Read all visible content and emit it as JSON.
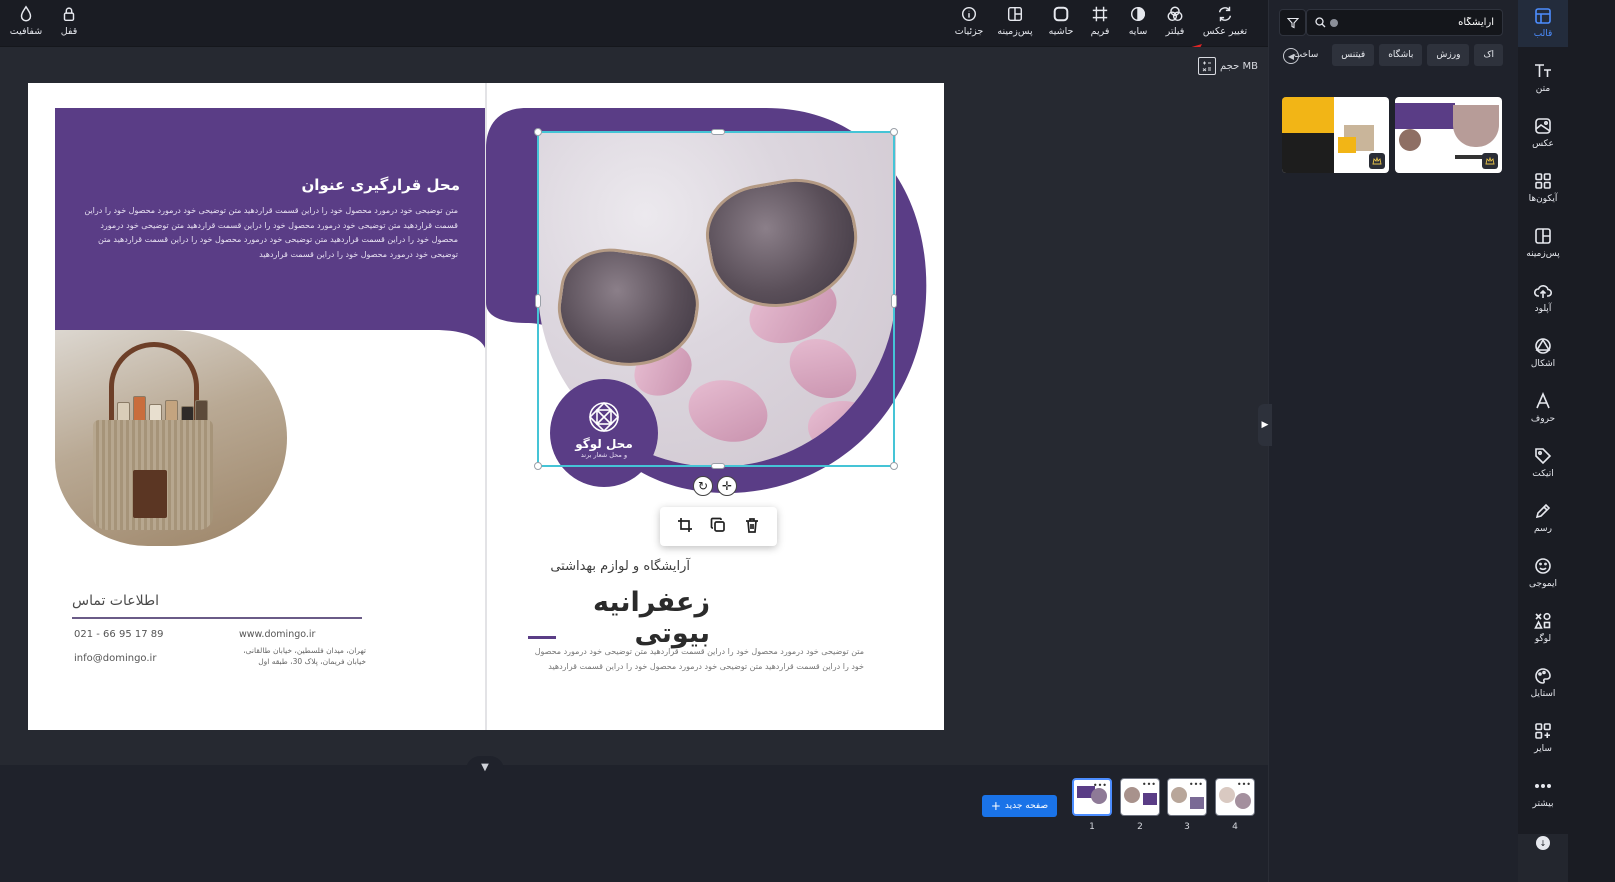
{
  "toolbar": {
    "transparency": "شفافیت",
    "lock": "قفل",
    "details": "جزئیات",
    "background": "پس‌زمینه",
    "border": "حاشیه",
    "frame": "فریم",
    "shadow": "سایه",
    "filter": "فیلتر",
    "change_photo": "تغییر عکس"
  },
  "size_info": "حجم MB",
  "design": {
    "left_title": "محل قرارگیری عنوان",
    "left_body": "متن توضیحی خود درمورد محصول خود را دراین قسمت قراردهید  متن توضیحی خود درمورد محصول خود را دراین قسمت قراردهید  متن توضیحی خود درمورد محصول خود را دراین قسمت قراردهید  متن توضیحی خود درمورد محصول خود را دراین قسمت قراردهید  متن توضیحی خود درمورد محصول خود را دراین قسمت قراردهید  متن توضیحی خود درمورد محصول خود را دراین قسمت قراردهید",
    "contact_title": "اطلاعات تماس",
    "phone": "021 - 66 95 17 89",
    "email": "info@domingo.ir",
    "website": "www.domingo.ir",
    "address": "تهران، میدان فلسطین، خیابان طالقانی، خیابان فریمان، پلاک 30، طبقه اول",
    "logo_title": "محل لوگو",
    "logo_sub": "و محل شعار برند",
    "right_sub": "آرایشگاه و لوازم بهداشتی",
    "right_title": "زعفرانیه بیوتی",
    "right_body": "متن توضیحی خود درمورد محصول خود را دراین قسمت قراردهید  متن توضیحی خود درمورد محصول خود را دراین قسمت قراردهید  متن توضیحی خود درمورد محصول خود را دراین قسمت قراردهید"
  },
  "bottom": {
    "new_page": "صفحه جدید",
    "pages": [
      "1",
      "2",
      "3",
      "4"
    ],
    "active_page": 1
  },
  "panel": {
    "search_value": "آرایشگاه",
    "chips": [
      "اک",
      "ورزش",
      "باشگاه",
      "فیتنس",
      "ساخت"
    ]
  },
  "rail": {
    "items": [
      "قالب",
      "متن",
      "عکس",
      "آیکون‌ها",
      "پس‌زمینه",
      "آپلود",
      "اشکال",
      "حروف",
      "اتیکت",
      "رسم",
      "ایموجی",
      "لوگو",
      "استایل",
      "سایر",
      "بیشتر"
    ]
  },
  "colors": {
    "brand_purple": "#5a3d86",
    "selection": "#45c4d6",
    "primary_blue": "#1a73e8",
    "annotation_arrow": "#e02424"
  }
}
